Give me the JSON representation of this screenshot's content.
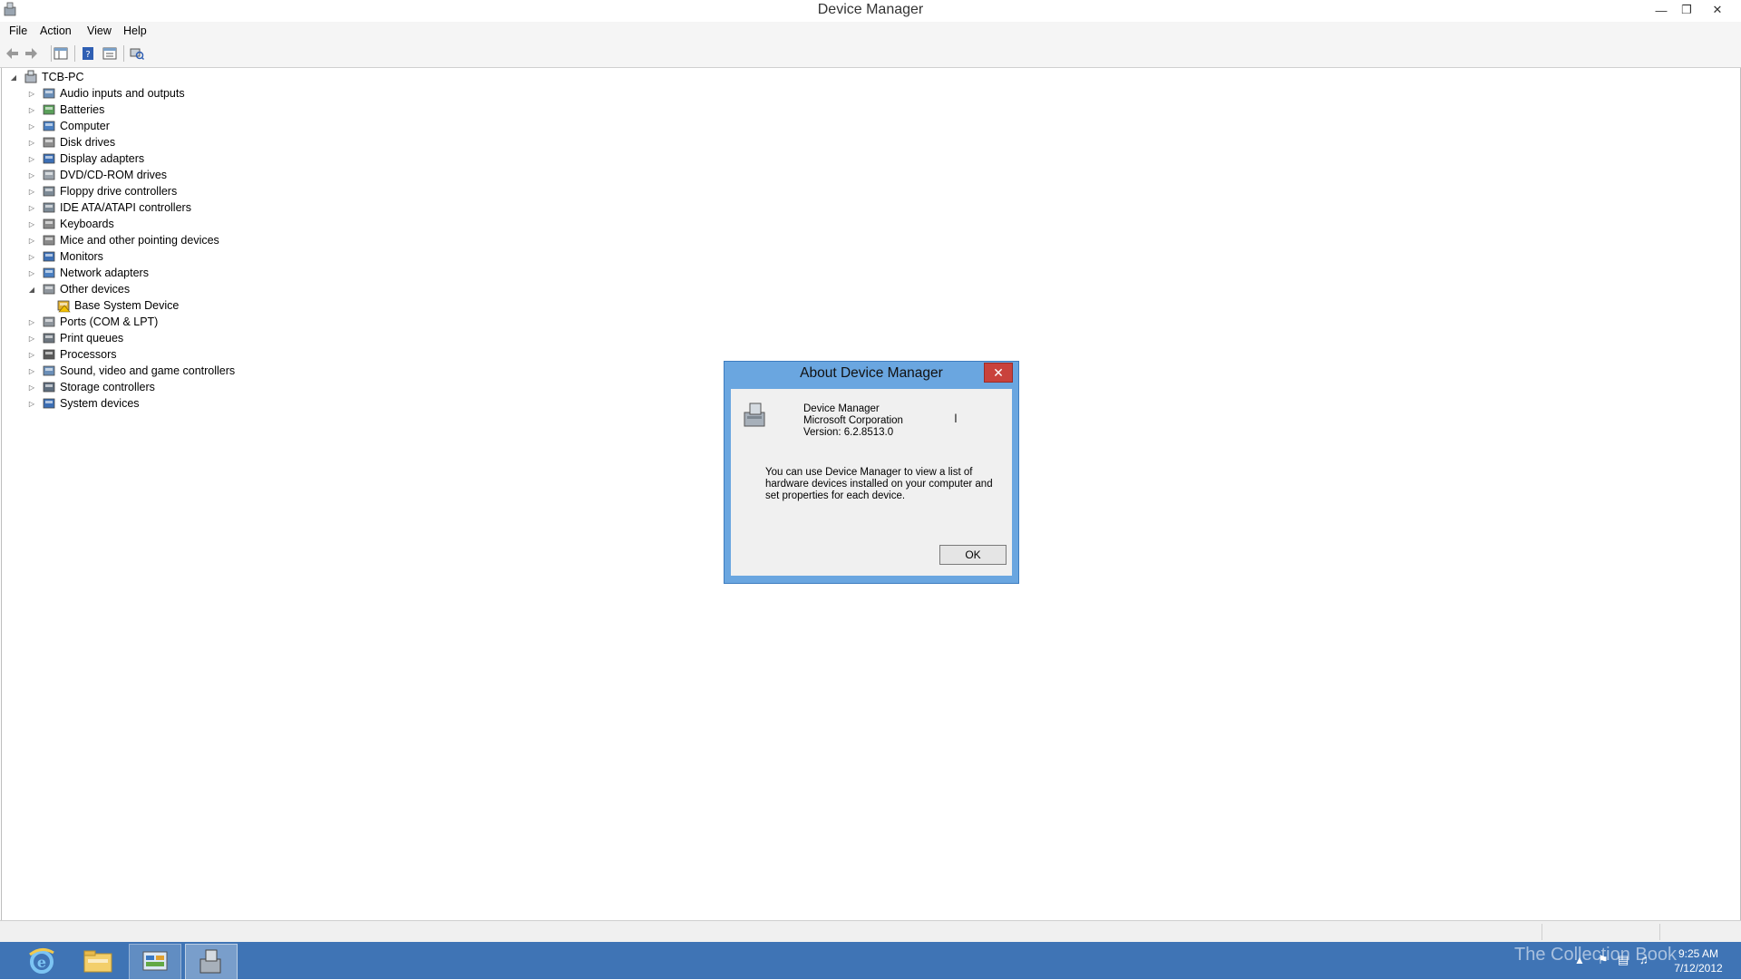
{
  "window": {
    "title": "Device Manager"
  },
  "menu": [
    "File",
    "Action",
    "View",
    "Help"
  ],
  "tree": {
    "root": "TCB-PC",
    "items": [
      {
        "label": "Audio inputs and outputs",
        "icon": "speaker-icon"
      },
      {
        "label": "Batteries",
        "icon": "battery-icon"
      },
      {
        "label": "Computer",
        "icon": "computer-icon"
      },
      {
        "label": "Disk drives",
        "icon": "disk-drive-icon"
      },
      {
        "label": "Display adapters",
        "icon": "display-adapter-icon"
      },
      {
        "label": "DVD/CD-ROM drives",
        "icon": "dvd-drive-icon"
      },
      {
        "label": "Floppy drive controllers",
        "icon": "floppy-controller-icon"
      },
      {
        "label": "IDE ATA/ATAPI controllers",
        "icon": "ide-controller-icon"
      },
      {
        "label": "Keyboards",
        "icon": "keyboard-icon"
      },
      {
        "label": "Mice and other pointing devices",
        "icon": "mouse-icon"
      },
      {
        "label": "Monitors",
        "icon": "monitor-icon"
      },
      {
        "label": "Network adapters",
        "icon": "network-adapter-icon"
      },
      {
        "label": "Other devices",
        "icon": "other-devices-icon",
        "expanded": true
      },
      {
        "label": "Base System Device",
        "icon": "warning-device-icon",
        "child": true
      },
      {
        "label": "Ports (COM & LPT)",
        "icon": "port-icon"
      },
      {
        "label": "Print queues",
        "icon": "printer-icon"
      },
      {
        "label": "Processors",
        "icon": "processor-icon"
      },
      {
        "label": "Sound, video and game controllers",
        "icon": "sound-controller-icon"
      },
      {
        "label": "Storage controllers",
        "icon": "storage-controller-icon"
      },
      {
        "label": "System devices",
        "icon": "system-devices-icon"
      }
    ]
  },
  "dialog": {
    "title": "About Device Manager",
    "product": "Device Manager",
    "company": "Microsoft Corporation",
    "version": "Version: 6.2.8513.0",
    "description_lines": [
      "You can use Device Manager to view a list of",
      "hardware devices installed on your computer and",
      "set properties for each device."
    ],
    "ok_label": "OK"
  },
  "taskbar": {
    "time": "9:25 AM",
    "date": "7/12/2012",
    "watermark": "The Collection Book"
  },
  "colors": {
    "taskbar": "#3f74b5",
    "dialog_frame": "#6aa6e0",
    "close_red": "#c9423c"
  }
}
